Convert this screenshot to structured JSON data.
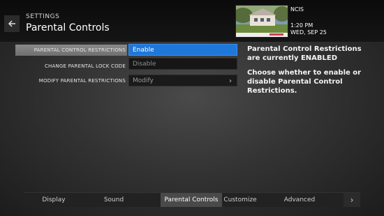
{
  "header": {
    "breadcrumb": "SETTINGS",
    "title": "Parental Controls",
    "back_icon": "arrow-left-icon"
  },
  "now_playing": {
    "show": "NCIS",
    "time": "1:20 PM",
    "date": "WED, SEP 25"
  },
  "menu": {
    "items": [
      {
        "label": "PARENTAL CONTROL RESTRICTIONS",
        "active": true
      },
      {
        "label": "CHANGE PARENTAL LOCK CODE",
        "active": false
      },
      {
        "label": "MODIFY PARENTAL RESTRICTIONS",
        "active": false
      }
    ]
  },
  "options": {
    "enable": "Enable",
    "disable": "Disable",
    "modify": "Modify",
    "chevron_icon": "chevron-right-icon"
  },
  "info": {
    "status": "Parental Control Restrictions are currently ENABLED",
    "description": "Choose whether to enable or disable Parental Control Restrictions."
  },
  "tabs": [
    {
      "label": "Display",
      "active": false
    },
    {
      "label": "Sound",
      "active": false
    },
    {
      "label": "Parental Controls",
      "active": true
    },
    {
      "label": "Customize",
      "active": false
    },
    {
      "label": "Advanced",
      "active": false
    }
  ],
  "colors": {
    "accent": "#1f78d8",
    "active_tab": "#4a4a4a"
  }
}
